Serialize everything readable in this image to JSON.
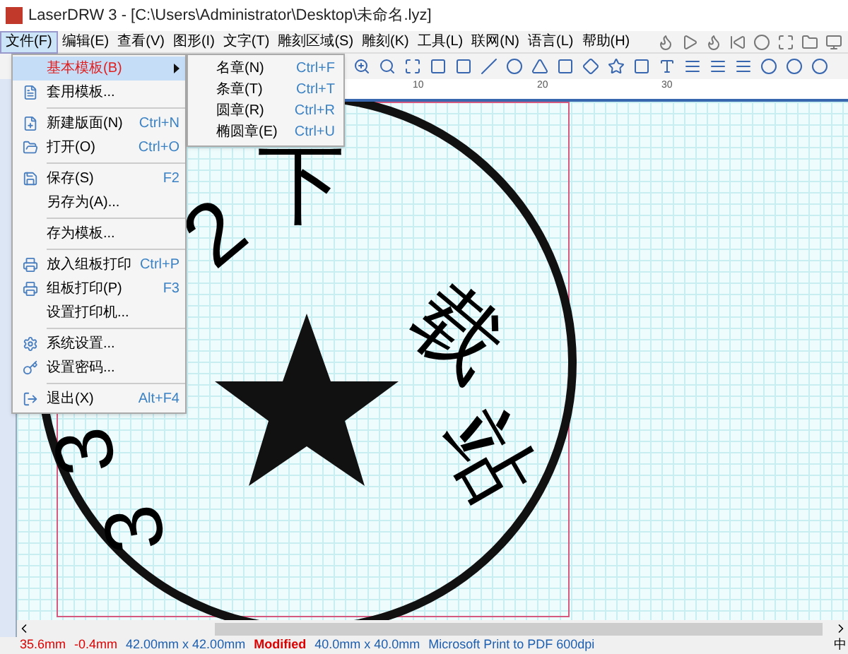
{
  "window": {
    "title": "LaserDRW 3 - [C:\\Users\\Administrator\\Desktop\\未命名.lyz]"
  },
  "menu_bar": [
    {
      "label": "文件(F)",
      "selected": true
    },
    {
      "label": "编辑(E)",
      "selected": false
    },
    {
      "label": "查看(V)",
      "selected": false
    },
    {
      "label": "图形(I)",
      "selected": false
    },
    {
      "label": "文字(T)",
      "selected": false
    },
    {
      "label": "雕刻区域(S)",
      "selected": false
    },
    {
      "label": "雕刻(K)",
      "selected": false
    },
    {
      "label": "工具(L)",
      "selected": false
    },
    {
      "label": "联网(N)",
      "selected": false
    },
    {
      "label": "语言(L)",
      "selected": false
    },
    {
      "label": "帮助(H)",
      "selected": false
    }
  ],
  "file_menu": [
    {
      "kind": "submenu",
      "label": "基本模板(B)",
      "selected": true
    },
    {
      "kind": "item",
      "label": "套用模板...",
      "selected": false
    },
    {
      "kind": "separator"
    },
    {
      "kind": "item",
      "label": "新建版面(N)",
      "shortcut": "Ctrl+N",
      "selected": false
    },
    {
      "kind": "item",
      "label": "打开(O)",
      "shortcut": "Ctrl+O",
      "selected": false
    },
    {
      "kind": "separator"
    },
    {
      "kind": "item",
      "label": "保存(S)",
      "shortcut": "F2",
      "selected": false
    },
    {
      "kind": "item",
      "label": "另存为(A)...",
      "selected": false
    },
    {
      "kind": "separator"
    },
    {
      "kind": "item",
      "label": "存为模板...",
      "selected": false
    },
    {
      "kind": "separator"
    },
    {
      "kind": "item",
      "label": "放入组板打印",
      "shortcut": "Ctrl+P",
      "selected": false
    },
    {
      "kind": "item",
      "label": "组板打印(P)",
      "shortcut": "F3",
      "selected": false
    },
    {
      "kind": "item",
      "label": "设置打印机...",
      "selected": false
    },
    {
      "kind": "separator"
    },
    {
      "kind": "item",
      "label": "系统设置...",
      "selected": false
    },
    {
      "kind": "item",
      "label": "设置密码...",
      "selected": false
    },
    {
      "kind": "separator"
    },
    {
      "kind": "item",
      "label": "退出(X)",
      "shortcut": "Alt+F4",
      "selected": false
    }
  ],
  "submenu": [
    {
      "label": "名章(N)",
      "shortcut": "Ctrl+F"
    },
    {
      "label": "条章(T)",
      "shortcut": "Ctrl+T"
    },
    {
      "label": "圆章(R)",
      "shortcut": "Ctrl+R"
    },
    {
      "label": "椭圆章(E)",
      "shortcut": "Ctrl+U"
    }
  ],
  "ruler": {
    "labels": [
      "10",
      "20",
      "30"
    ]
  },
  "stamp": {
    "characters": [
      "2",
      "下",
      "载",
      "站",
      "3",
      "3"
    ]
  },
  "status_bar": {
    "x": "35.6mm",
    "y": "-0.4mm",
    "size": "42.00mm x 42.00mm",
    "state": "Modified",
    "page": "40.0mm x 40.0mm",
    "printer": "Microsoft Print to PDF 600dpi",
    "ime": "中"
  }
}
